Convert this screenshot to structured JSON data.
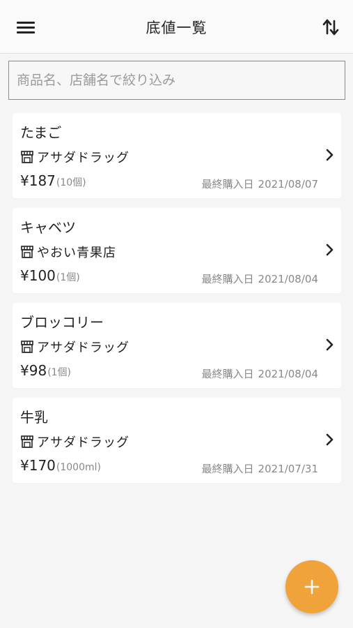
{
  "header": {
    "title": "底値一覧",
    "menu_icon": "hamburger-menu-icon",
    "sort_icon": "sort-arrows-icon"
  },
  "search": {
    "placeholder": "商品名、店舗名で絞り込み",
    "value": ""
  },
  "items": [
    {
      "name": "たまご",
      "store": "アサダドラッグ",
      "price": "¥187",
      "qty": "(10個)",
      "date_label": "最終購入日",
      "date": "2021/08/07"
    },
    {
      "name": "キャベツ",
      "store": "やおい青果店",
      "price": "¥100",
      "qty": "(1個)",
      "date_label": "最終購入日",
      "date": "2021/08/04"
    },
    {
      "name": "ブロッコリー",
      "store": "アサダドラッグ",
      "price": "¥98",
      "qty": "(1個)",
      "date_label": "最終購入日",
      "date": "2021/08/04"
    },
    {
      "name": "牛乳",
      "store": "アサダドラッグ",
      "price": "¥170",
      "qty": "(1000ml)",
      "date_label": "最終購入日",
      "date": "2021/07/31"
    }
  ],
  "fab": {
    "icon": "plus-icon"
  },
  "colors": {
    "accent": "#f0a33a",
    "background": "#f5f5f5",
    "card": "#ffffff",
    "muted_text": "#888888"
  }
}
